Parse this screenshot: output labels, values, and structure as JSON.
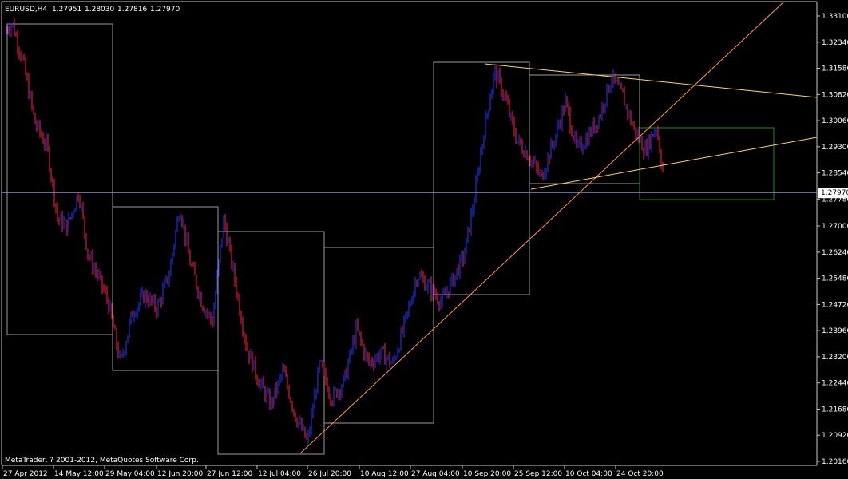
{
  "header": {
    "symbol": "EURUSD,H4",
    "open": "1.27951",
    "high": "1.28030",
    "low": "1.27816",
    "close": "1.27970"
  },
  "footer": {
    "copyright": "MetaTrader, ? 2001-2012, MetaQuotes Software Corp."
  },
  "colors": {
    "background": "#000000",
    "bull_candle": "#1f3cff",
    "bear_candle": "#ff1f4a",
    "box": "#9a9a9a",
    "trend_orange": "#ff9a3c",
    "trend_yellow": "#ffd75a",
    "target_box": "#1e8a1e",
    "price_line": "#8c8cd0"
  },
  "chart_data": {
    "type": "candlestick",
    "symbol": "EURUSD",
    "timeframe": "H4",
    "y_ticks": [
      "1.33100",
      "1.32340",
      "1.31580",
      "1.30820",
      "1.30060",
      "1.29300",
      "1.28540",
      "1.27780",
      "1.27000",
      "1.26240",
      "1.25480",
      "1.24720",
      "1.23960",
      "1.23200",
      "1.22440",
      "1.21680",
      "1.20920",
      "1.20160"
    ],
    "ylim": [
      1.2016,
      1.331
    ],
    "current_price": "1.27970",
    "x_ticks": [
      "27 Apr 2012",
      "14 May 12:00",
      "29 May 04:00",
      "12 Jun 20:00",
      "27 Jun 12:00",
      "12 Jul 04:00",
      "26 Jul 20:00",
      "10 Aug 12:00",
      "27 Aug 04:00",
      "10 Sep 20:00",
      "25 Sep 12:00",
      "10 Oct 04:00",
      "24 Oct 20:00"
    ],
    "path": [
      {
        "t": 0.0,
        "p": 1.326
      },
      {
        "t": 0.012,
        "p": 1.329
      },
      {
        "t": 0.025,
        "p": 1.318
      },
      {
        "t": 0.04,
        "p": 1.3
      },
      {
        "t": 0.055,
        "p": 1.293
      },
      {
        "t": 0.068,
        "p": 1.272
      },
      {
        "t": 0.08,
        "p": 1.27
      },
      {
        "t": 0.094,
        "p": 1.28
      },
      {
        "t": 0.105,
        "p": 1.262
      },
      {
        "t": 0.118,
        "p": 1.255
      },
      {
        "t": 0.13,
        "p": 1.248
      },
      {
        "t": 0.145,
        "p": 1.23
      },
      {
        "t": 0.16,
        "p": 1.245
      },
      {
        "t": 0.175,
        "p": 1.25
      },
      {
        "t": 0.19,
        "p": 1.246
      },
      {
        "t": 0.205,
        "p": 1.256
      },
      {
        "t": 0.218,
        "p": 1.276
      },
      {
        "t": 0.23,
        "p": 1.26
      },
      {
        "t": 0.245,
        "p": 1.248
      },
      {
        "t": 0.258,
        "p": 1.242
      },
      {
        "t": 0.272,
        "p": 1.272
      },
      {
        "t": 0.285,
        "p": 1.255
      },
      {
        "t": 0.3,
        "p": 1.235
      },
      {
        "t": 0.315,
        "p": 1.225
      },
      {
        "t": 0.33,
        "p": 1.218
      },
      {
        "t": 0.345,
        "p": 1.228
      },
      {
        "t": 0.36,
        "p": 1.215
      },
      {
        "t": 0.375,
        "p": 1.207
      },
      {
        "t": 0.39,
        "p": 1.23
      },
      {
        "t": 0.405,
        "p": 1.22
      },
      {
        "t": 0.42,
        "p": 1.225
      },
      {
        "t": 0.435,
        "p": 1.24
      },
      {
        "t": 0.45,
        "p": 1.23
      },
      {
        "t": 0.465,
        "p": 1.233
      },
      {
        "t": 0.48,
        "p": 1.23
      },
      {
        "t": 0.495,
        "p": 1.242
      },
      {
        "t": 0.51,
        "p": 1.256
      },
      {
        "t": 0.525,
        "p": 1.252
      },
      {
        "t": 0.54,
        "p": 1.248
      },
      {
        "t": 0.555,
        "p": 1.255
      },
      {
        "t": 0.568,
        "p": 1.262
      },
      {
        "t": 0.58,
        "p": 1.278
      },
      {
        "t": 0.592,
        "p": 1.298
      },
      {
        "t": 0.605,
        "p": 1.315
      },
      {
        "t": 0.618,
        "p": 1.307
      },
      {
        "t": 0.632,
        "p": 1.295
      },
      {
        "t": 0.648,
        "p": 1.29
      },
      {
        "t": 0.662,
        "p": 1.284
      },
      {
        "t": 0.678,
        "p": 1.295
      },
      {
        "t": 0.692,
        "p": 1.306
      },
      {
        "t": 0.706,
        "p": 1.292
      },
      {
        "t": 0.72,
        "p": 1.296
      },
      {
        "t": 0.734,
        "p": 1.302
      },
      {
        "t": 0.748,
        "p": 1.313
      },
      {
        "t": 0.762,
        "p": 1.308
      },
      {
        "t": 0.776,
        "p": 1.298
      },
      {
        "t": 0.79,
        "p": 1.292
      },
      {
        "t": 0.804,
        "p": 1.299
      },
      {
        "t": 0.815,
        "p": 1.28
      }
    ]
  }
}
